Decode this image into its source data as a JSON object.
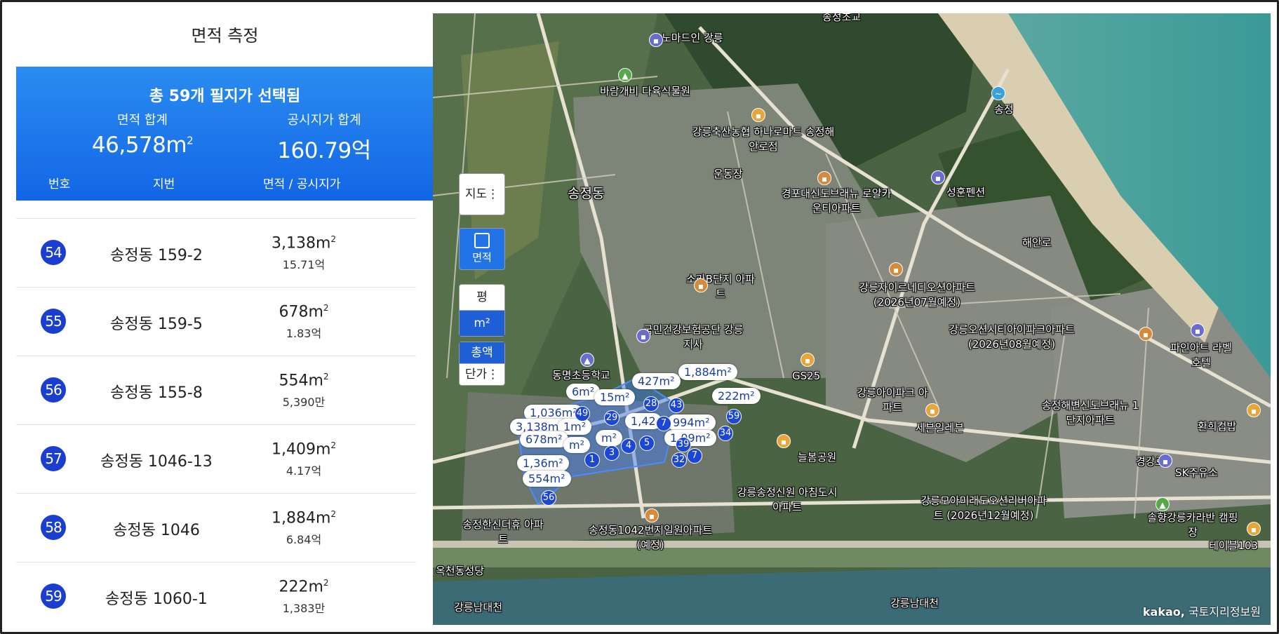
{
  "panel": {
    "title": "면적 측정",
    "summary": {
      "headline": "총 59개 필지가 선택됨",
      "area_label": "면적 합계",
      "area_value": "46,578m",
      "area_unit": "2",
      "price_label": "공시지가 합계",
      "price_value": "160.79억"
    },
    "columns": {
      "no": "번호",
      "jibun": "지번",
      "area_price": "면적 / 공시지가"
    },
    "rows": [
      {
        "no": "54",
        "jibun": "송정동 159-2",
        "area": "3,138m",
        "price": "15.71억"
      },
      {
        "no": "55",
        "jibun": "송정동 159-5",
        "area": "678m",
        "price": "1.83억"
      },
      {
        "no": "56",
        "jibun": "송정동 155-8",
        "area": "554m",
        "price": "5,390만"
      },
      {
        "no": "57",
        "jibun": "송정동 1046-13",
        "area": "1,409m",
        "price": "4.17억"
      },
      {
        "no": "58",
        "jibun": "송정동 1046",
        "area": "1,884m",
        "price": "6.84억"
      },
      {
        "no": "59",
        "jibun": "송정동 1060-1",
        "area": "222m",
        "price": "1,383만"
      }
    ],
    "sq": "2"
  },
  "map": {
    "controls": {
      "map_type": "지도",
      "area_label": "면적",
      "unit_pyeong": "평",
      "unit_m2": "m²",
      "total": "총액",
      "unit_price": "단가"
    },
    "labels": [
      "송정초교",
      "노마드인 강릉",
      "바람개비 다육식물원",
      "송정",
      "강릉축산농협 하나로마트 송정해안로점",
      "운동장",
      "송정동",
      "경포대신도브래뉴 로얄카운티아파트",
      "성훈펜션",
      "해안로",
      "소라B단지 아파트",
      "강릉자이르네디오션아파트 (2026년07월예정)",
      "국민건강보험공단 강릉지사",
      "강릉오션시티아이파크아파트 (2026년08월예정)",
      "파인아트 라벨호텔",
      "동명초등학교",
      "GS25",
      "강릉아이파크 아파트",
      "송정해변신도브래뉴 1단지아파트",
      "세븐일레븐",
      "환희컵밥",
      "늘봄공원",
      "경강로",
      "SK주유소",
      "강릉송정신원 아침도시아파트",
      "강릉모아미래도오션리버아파트 (2026년12월예정)",
      "솔향강릉카라반 캠핑장",
      "송정한신더휴 아파트",
      "송정동1042번지일원아파트 (예정)",
      "테이블103",
      "옥천동성당",
      "강릉남대천",
      "강릉남대천"
    ],
    "bubbles": [
      "427m²",
      "1,884m²",
      "6m²",
      "222m²",
      "15m²",
      "1,036m²",
      "3,138m²",
      "1m²",
      "1,42",
      "994m²",
      "678m²",
      "m²",
      "m²",
      "1,09m²",
      "1,36m²",
      "554m²"
    ],
    "markers": [
      "49",
      "28",
      "43",
      "29",
      "7",
      "59",
      "34",
      "3",
      "4",
      "5",
      "1",
      "39",
      "32",
      "7",
      "56"
    ],
    "watermark": "kakao",
    "credit_brand": "kakao,",
    "credit_text": "국토지리정보원"
  }
}
